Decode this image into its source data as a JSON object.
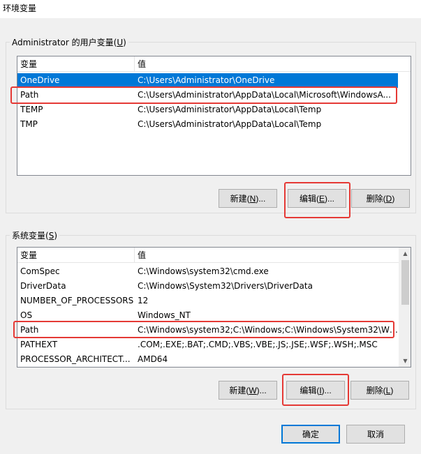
{
  "window": {
    "title": "环境变量"
  },
  "user_vars": {
    "group_label_pre": "Administrator 的用户变量(",
    "group_label_key": "U",
    "group_label_post": ")",
    "columns": [
      "变量",
      "值"
    ],
    "rows": [
      {
        "name": "OneDrive",
        "value": "C:\\Users\\Administrator\\OneDrive",
        "selected": true
      },
      {
        "name": "Path",
        "value": "C:\\Users\\Administrator\\AppData\\Local\\Microsoft\\WindowsA..."
      },
      {
        "name": "TEMP",
        "value": "C:\\Users\\Administrator\\AppData\\Local\\Temp"
      },
      {
        "name": "TMP",
        "value": "C:\\Users\\Administrator\\AppData\\Local\\Temp"
      }
    ],
    "buttons": {
      "new": {
        "pre": "新建(",
        "key": "N",
        "post": ")..."
      },
      "edit": {
        "pre": "编辑(",
        "key": "E",
        "post": ")..."
      },
      "delete": {
        "pre": "删除(",
        "key": "D",
        "post": ")"
      }
    }
  },
  "system_vars": {
    "group_label_pre": "系统变量(",
    "group_label_key": "S",
    "group_label_post": ")",
    "columns": [
      "变量",
      "值"
    ],
    "rows": [
      {
        "name": "ComSpec",
        "value": "C:\\Windows\\system32\\cmd.exe"
      },
      {
        "name": "DriverData",
        "value": "C:\\Windows\\System32\\Drivers\\DriverData"
      },
      {
        "name": "NUMBER_OF_PROCESSORS",
        "value": "12"
      },
      {
        "name": "OS",
        "value": "Windows_NT"
      },
      {
        "name": "Path",
        "value": "C:\\Windows\\system32;C:\\Windows;C:\\Windows\\System32\\Wb..."
      },
      {
        "name": "PATHEXT",
        "value": ".COM;.EXE;.BAT;.CMD;.VBS;.VBE;.JS;.JSE;.WSF;.WSH;.MSC"
      },
      {
        "name": "PROCESSOR_ARCHITECT...",
        "value": "AMD64"
      }
    ],
    "buttons": {
      "new": {
        "pre": "新建(",
        "key": "W",
        "post": ")..."
      },
      "edit": {
        "pre": "编辑(",
        "key": "I",
        "post": ")..."
      },
      "delete": {
        "pre": "删除(",
        "key": "L",
        "post": ")"
      }
    }
  },
  "footer": {
    "ok": "确定",
    "cancel": "取消"
  },
  "colors": {
    "selection": "#0078d7",
    "highlight": "#e53935"
  },
  "icons": {
    "scroll_up": "up-arrow-icon",
    "scroll_down": "down-arrow-icon"
  }
}
